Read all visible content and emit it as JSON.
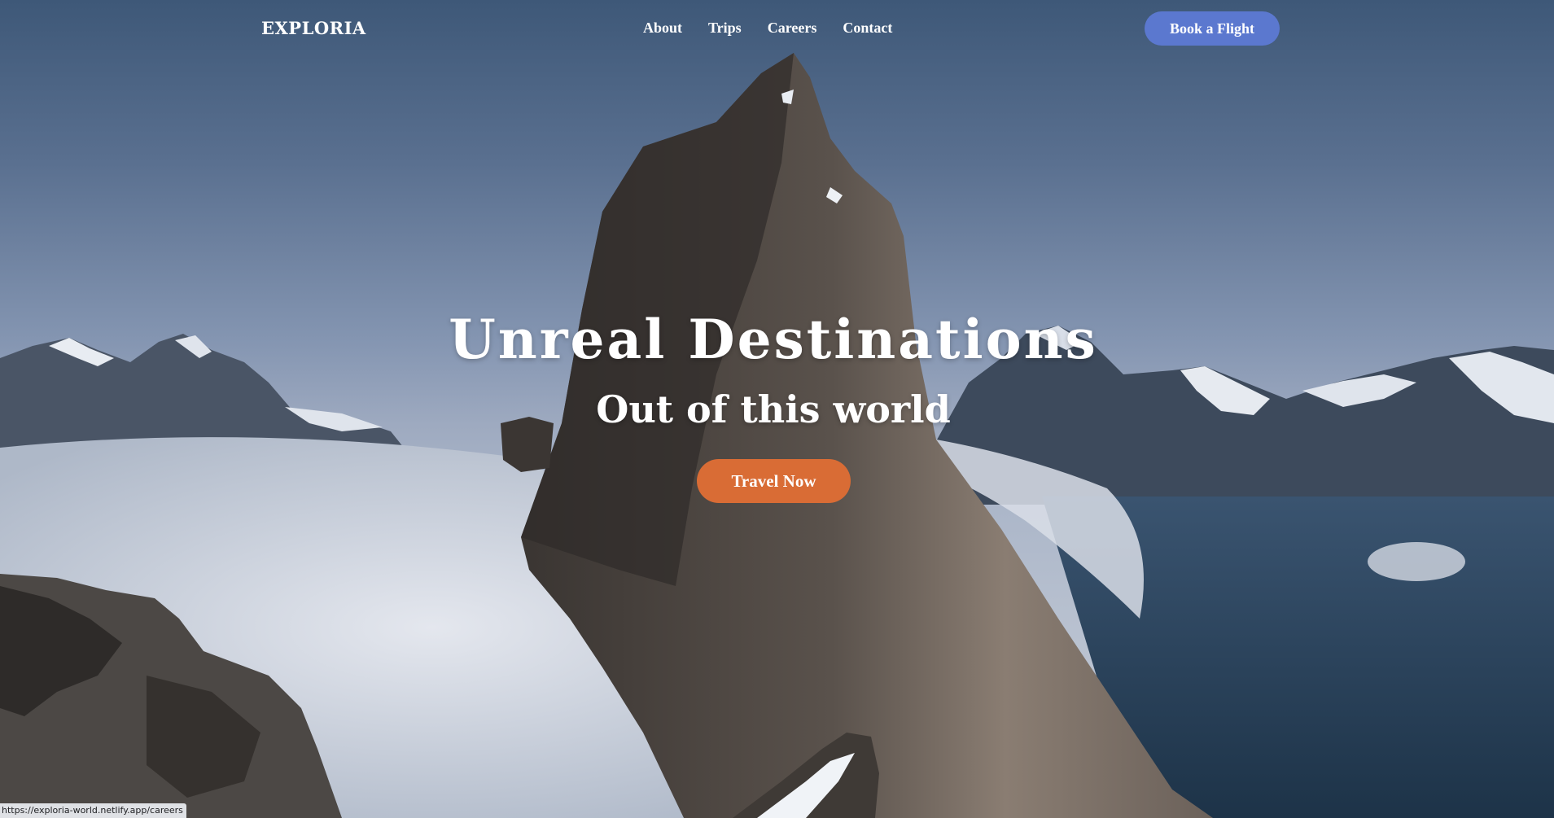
{
  "brand": {
    "logo": "EXPLORIA"
  },
  "nav": {
    "links": [
      {
        "label": "About"
      },
      {
        "label": "Trips"
      },
      {
        "label": "Careers"
      },
      {
        "label": "Contact"
      }
    ],
    "cta_label": "Book a Flight"
  },
  "hero": {
    "title": "Unreal Destinations",
    "subtitle": "Out of this world",
    "cta_label": "Travel Now"
  },
  "status_bar": {
    "url": "https://exploria-world.netlify.app/careers"
  },
  "colors": {
    "book_button": "#5b78cf",
    "travel_button": "#d96c35",
    "text": "#ffffff"
  }
}
